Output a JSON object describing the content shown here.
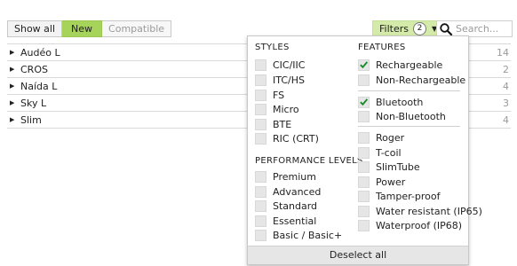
{
  "toolbar": {
    "segments": [
      "Show all",
      "New",
      "Compatible"
    ],
    "filters_label": "Filters",
    "filters_count": "2",
    "search_placeholder": "Search..."
  },
  "products": [
    {
      "name": "Audéo L",
      "count": "14"
    },
    {
      "name": "CROS",
      "count": "2"
    },
    {
      "name": "Naída L",
      "count": "4"
    },
    {
      "name": "Sky L",
      "count": "3"
    },
    {
      "name": "Slim",
      "count": "4"
    }
  ],
  "filters": {
    "styles_heading": "STYLES",
    "styles": [
      "CIC/IIC",
      "ITC/HS",
      "FS",
      "Micro",
      "BTE",
      "RIC (CRT)"
    ],
    "performance_heading": "PERFORMANCE LEVELS",
    "performance": [
      "Premium",
      "Advanced",
      "Standard",
      "Essential",
      "Basic / Basic+"
    ],
    "features_heading": "FEATURES",
    "features_power": [
      {
        "label": "Rechargeable",
        "checked": true
      },
      {
        "label": "Non-Rechargeable",
        "checked": false
      }
    ],
    "features_connectivity": [
      {
        "label": "Bluetooth",
        "checked": true
      },
      {
        "label": "Non-Bluetooth",
        "checked": false
      }
    ],
    "features_other": [
      "Roger",
      "T-coil",
      "SlimTube",
      "Power",
      "Tamper-proof",
      "Water resistant (IP65)",
      "Waterproof (IP68)"
    ],
    "deselect_all": "Deselect all"
  },
  "colors": {
    "accent_green": "#a6d35a",
    "filters_button": "#d4eaa9",
    "check_green": "#1a8a2a"
  }
}
